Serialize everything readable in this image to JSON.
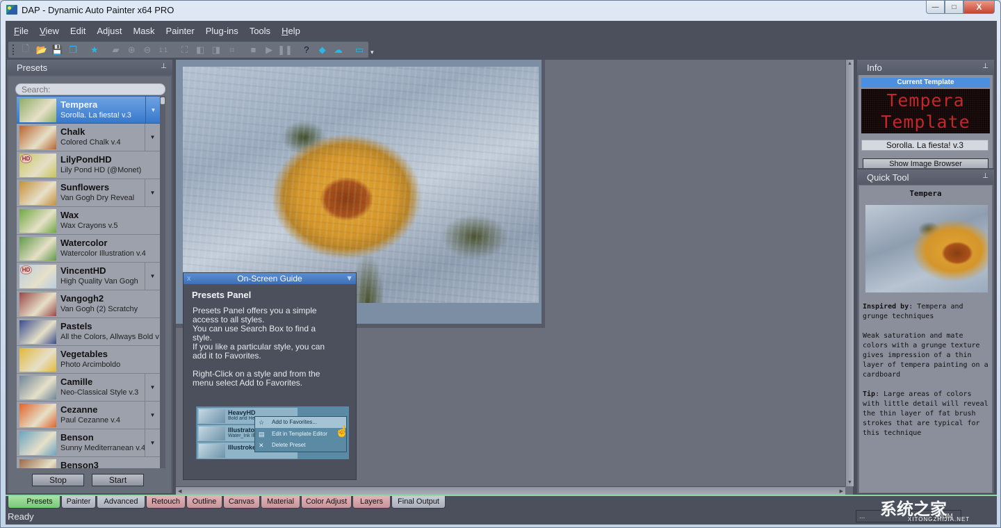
{
  "window": {
    "title": "DAP - Dynamic Auto Painter x64 PRO",
    "controls": {
      "minimize": "—",
      "maximize": "□",
      "close": "X"
    }
  },
  "menu": [
    {
      "label": "File",
      "mnemonic": "F",
      "rest": "ile"
    },
    {
      "label": "View",
      "mnemonic": "V",
      "rest": "iew"
    },
    {
      "label": "Edit",
      "mnemonic": "",
      "rest": "Edit"
    },
    {
      "label": "Adjust",
      "mnemonic": "",
      "rest": "Adjust"
    },
    {
      "label": "Mask",
      "mnemonic": "",
      "rest": "Mask"
    },
    {
      "label": "Painter",
      "mnemonic": "",
      "rest": "Painter"
    },
    {
      "label": "Plug-ins",
      "mnemonic": "",
      "rest": "Plug-ins"
    },
    {
      "label": "Tools",
      "mnemonic": "",
      "rest": "Tools"
    },
    {
      "label": "Help",
      "mnemonic": "H",
      "rest": "elp"
    }
  ],
  "toolbar": [
    {
      "icon": "new-file-icon",
      "glyph": "🗋",
      "enabled": false
    },
    {
      "icon": "open-folder-icon",
      "glyph": "📂",
      "enabled": true
    },
    {
      "icon": "save-icon",
      "glyph": "💾",
      "enabled": true
    },
    {
      "icon": "save-as-icon",
      "glyph": "❐",
      "enabled": true
    },
    {
      "icon": "favorites-star-icon",
      "glyph": "★",
      "enabled": true
    },
    {
      "icon": "open-image-icon",
      "glyph": "▰",
      "enabled": false
    },
    {
      "icon": "zoom-in-icon",
      "glyph": "⊕",
      "enabled": false
    },
    {
      "icon": "zoom-out-icon",
      "glyph": "⊖",
      "enabled": false
    },
    {
      "icon": "actual-size-icon",
      "glyph": "1:1",
      "enabled": false
    },
    {
      "icon": "fit-window-icon",
      "glyph": "⛶",
      "enabled": false
    },
    {
      "icon": "resize-icon",
      "glyph": "◧",
      "enabled": false
    },
    {
      "icon": "canvas-size-icon",
      "glyph": "◨",
      "enabled": false
    },
    {
      "icon": "crop-icon",
      "glyph": "⌗",
      "enabled": false
    },
    {
      "icon": "stop-icon",
      "glyph": "■",
      "enabled": false
    },
    {
      "icon": "play-icon",
      "glyph": "▶",
      "enabled": false
    },
    {
      "icon": "pause-icon",
      "glyph": "❚❚",
      "enabled": false
    },
    {
      "icon": "help-icon",
      "glyph": "?",
      "enabled": true
    },
    {
      "icon": "manual-book-icon",
      "glyph": "◆",
      "enabled": true
    },
    {
      "icon": "download-cloud-icon",
      "glyph": "☁",
      "enabled": true
    },
    {
      "icon": "screen-mode-icon",
      "glyph": "▭",
      "enabled": true
    }
  ],
  "presets_panel": {
    "title": "Presets",
    "search_placeholder": "Search:",
    "items": [
      {
        "name": "Tempera",
        "subtitle": "Sorolla. La fiesta! v.3",
        "selected": true,
        "has_dropdown": true,
        "hd": false,
        "thumb": "#8fae6a"
      },
      {
        "name": "Chalk",
        "subtitle": "Colored Chalk v.4",
        "selected": false,
        "has_dropdown": true,
        "hd": false,
        "thumb": "#b8652f"
      },
      {
        "name": "LilyPondHD",
        "subtitle": "Lily Pond HD (@Monet)",
        "selected": false,
        "has_dropdown": false,
        "hd": true,
        "thumb": "#c8c45a"
      },
      {
        "name": "Sunflowers",
        "subtitle": "Van Gogh Dry Reveal",
        "selected": false,
        "has_dropdown": true,
        "hd": false,
        "thumb": "#c7903a"
      },
      {
        "name": "Wax",
        "subtitle": "Wax Crayons v.5",
        "selected": false,
        "has_dropdown": false,
        "hd": false,
        "thumb": "#6ea940"
      },
      {
        "name": "Watercolor",
        "subtitle": "Watercolor Illustration v.4",
        "selected": false,
        "has_dropdown": false,
        "hd": false,
        "thumb": "#5f9a48"
      },
      {
        "name": "VincentHD",
        "subtitle": "High Quality Van Gogh",
        "selected": false,
        "has_dropdown": true,
        "hd": true,
        "thumb": "#b7cde0"
      },
      {
        "name": "Vangogh2",
        "subtitle": "Van Gogh (2) Scratchy",
        "selected": false,
        "has_dropdown": false,
        "hd": false,
        "thumb": "#9a4848"
      },
      {
        "name": "Pastels",
        "subtitle": "All the Colors, Allways Bold v",
        "selected": false,
        "has_dropdown": false,
        "hd": false,
        "thumb": "#3a4d8e"
      },
      {
        "name": "Vegetables",
        "subtitle": "Photo Arcimboldo",
        "selected": false,
        "has_dropdown": false,
        "hd": false,
        "thumb": "#e2b73a"
      },
      {
        "name": "Camille",
        "subtitle": "Neo-Classical Style v.3",
        "selected": false,
        "has_dropdown": true,
        "hd": false,
        "thumb": "#6f8799"
      },
      {
        "name": "Cezanne",
        "subtitle": "Paul Cezanne v.4",
        "selected": false,
        "has_dropdown": true,
        "hd": false,
        "thumb": "#e0642a"
      },
      {
        "name": "Benson",
        "subtitle": "Sunny Mediterranean v.4",
        "selected": false,
        "has_dropdown": true,
        "hd": false,
        "thumb": "#6aa5c2"
      },
      {
        "name": "Benson3",
        "subtitle": "",
        "selected": false,
        "has_dropdown": false,
        "hd": false,
        "thumb": "#9a6a4a"
      }
    ],
    "stop_label": "Stop",
    "start_label": "Start"
  },
  "guide": {
    "header": "On-Screen Guide",
    "close": "x",
    "collapse": "▼",
    "title": "Presets Panel",
    "text": "Presets Panel offers you a simple\naccess to all styles.\nYou can use Search Box to find a\nstyle.\nIf you like a particular style, you can\nadd it to Favorites.\n\nRight-Click on a style and from the\nmenu select Add to Favorites.",
    "example": {
      "rows": [
        {
          "name": "HeavyHD",
          "sub": "Bold and He"
        },
        {
          "name": "Illustrator",
          "sub": "Water_Ink Ill"
        },
        {
          "name": "Illustroke Wide",
          "sub": ""
        }
      ],
      "menu": [
        "Add to Favorites...",
        "Edit in Template Editor",
        "Delete Preset"
      ]
    }
  },
  "info_panel": {
    "title": "Info",
    "current_template_label": "Current Template",
    "led_lines": [
      "Tempera",
      "Template"
    ],
    "template_value": "Sorolla. La fiesta! v.3",
    "show_browser_label": "Show Image Browser"
  },
  "quick_tool": {
    "title": "Quick Tool",
    "style_name": "Tempera",
    "inspired_label": "Inspired by",
    "inspired_text": ": Tempera and grunge techniques",
    "description": "Weak saturation and mate colors with a grunge texture gives impression of a thin layer of tempera painting on a cardboard",
    "tip_label": "Tip",
    "tip_text": ": Large areas of colors with little detail will reveal the thin layer of fat brush strokes that are typical for this technique"
  },
  "tabs": [
    {
      "label": "Presets",
      "color": "green",
      "active": true
    },
    {
      "label": "Painter",
      "color": "gray",
      "active": false
    },
    {
      "label": "Advanced",
      "color": "gray",
      "active": false
    },
    {
      "label": "Retouch",
      "color": "pink",
      "active": false
    },
    {
      "label": "Outline",
      "color": "pink",
      "active": false
    },
    {
      "label": "Canvas",
      "color": "pink",
      "active": false
    },
    {
      "label": "Material",
      "color": "pink",
      "active": false
    },
    {
      "label": "Color Adjust",
      "color": "pink",
      "active": false
    },
    {
      "label": "Layers",
      "color": "pink",
      "active": false
    },
    {
      "label": "Final Output",
      "color": "gray",
      "active": false
    }
  ],
  "status": {
    "text": "Ready",
    "cells": [
      "...",
      "",
      "NUM"
    ]
  },
  "watermark": {
    "text": "系统之家",
    "sub": "XITONGZHIJIA.NET"
  }
}
